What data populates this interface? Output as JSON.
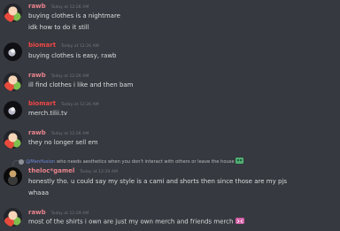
{
  "messages": [
    {
      "author": "rawb",
      "timestamp": "Today at 12:26 AM",
      "lines": [
        "buying clothes is a nightmare",
        "idk how to do it still"
      ]
    },
    {
      "author": "biomart",
      "timestamp": "Today at 12:26 AM",
      "lines": [
        "buying clothes is easy, rawb"
      ]
    },
    {
      "author": "rawb",
      "timestamp": "Today at 12:26 AM",
      "lines": [
        "ill find clothes i like and then bam"
      ]
    },
    {
      "author": "biomart",
      "timestamp": "Today at 12:26 AM",
      "lines": [
        "merch.tilii.tv"
      ]
    },
    {
      "author": "rawb",
      "timestamp": "Today at 12:26 AM",
      "lines": [
        "they no longer sell em"
      ]
    },
    {
      "author": "theloc*gamel",
      "timestamp": "Today at 12:29 AM",
      "lines": [
        "honestly tho. u could say my style is a cami and shorts then since those are my pjs",
        "whaaa"
      ]
    },
    {
      "author": "rawb",
      "timestamp": "Today at 12:29 AM",
      "lines": [
        "most of the shirts i own are just my own merch and friends merch"
      ]
    }
  ],
  "reply": {
    "mention": "@Manifusion",
    "text": "who needs aesthetics when you don't interact with others or leave the house"
  },
  "colors": {
    "background": "#36393f",
    "rawb_name": "#e9838d",
    "biomart_name": "#f04747",
    "timestamp": "#72767d",
    "text": "#dcddde",
    "mention": "#7289da"
  },
  "icons": {
    "reply_emoji": "green-pepe-emoji",
    "message_emoji": "pink-emoji"
  }
}
